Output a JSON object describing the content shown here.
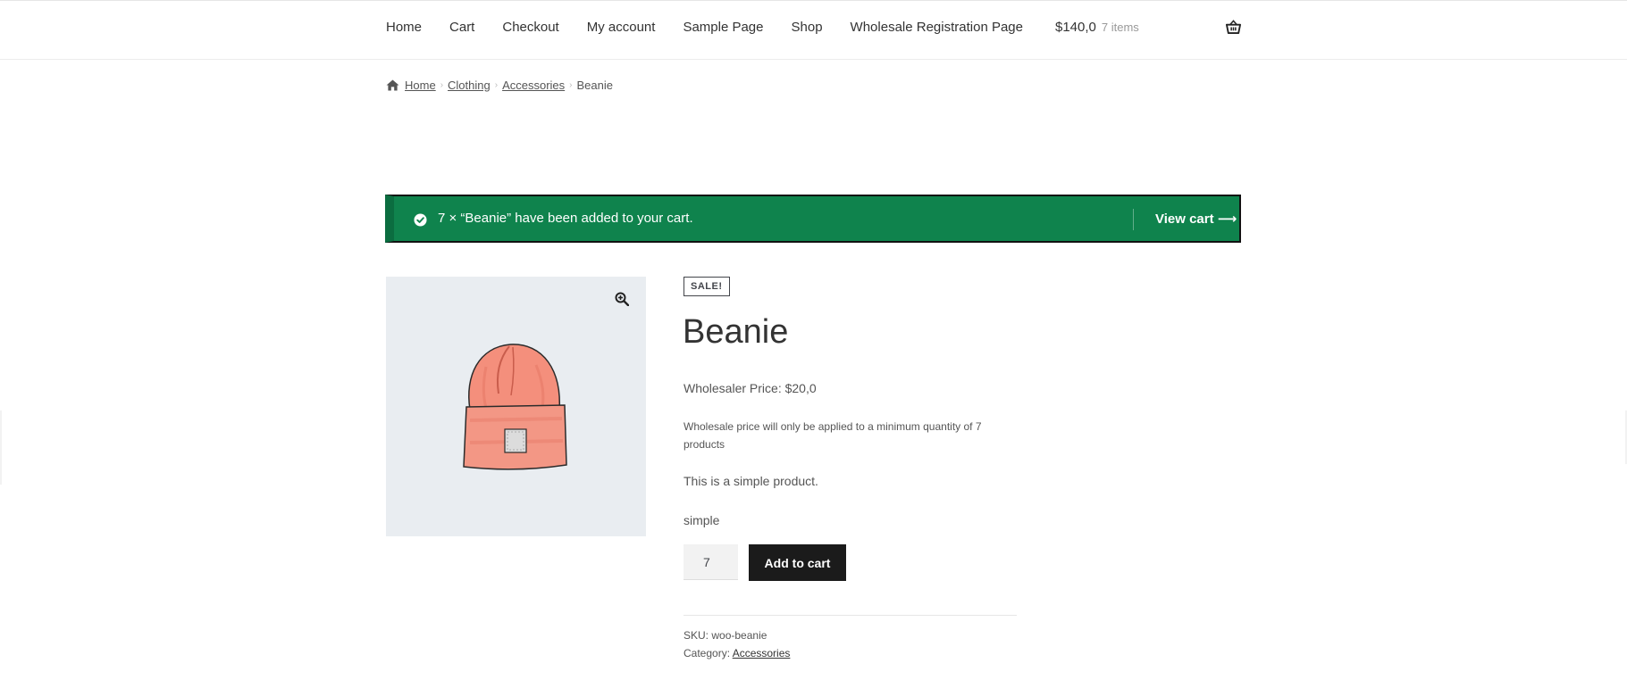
{
  "nav": {
    "items": [
      {
        "label": "Home"
      },
      {
        "label": "Cart"
      },
      {
        "label": "Checkout"
      },
      {
        "label": "My account"
      },
      {
        "label": "Sample Page"
      },
      {
        "label": "Shop"
      },
      {
        "label": "Wholesale Registration Page"
      }
    ]
  },
  "cart": {
    "total": "$140,0",
    "count": "7 items",
    "icon": "basket-icon"
  },
  "breadcrumb": {
    "home_icon": "home-icon",
    "items": [
      {
        "label": "Home",
        "link": true
      },
      {
        "label": "Clothing",
        "link": true
      },
      {
        "label": "Accessories",
        "link": true
      },
      {
        "label": "Beanie",
        "link": false
      }
    ],
    "separator": "›"
  },
  "notice": {
    "icon": "check-circle-icon",
    "message": "7 × “Beanie” have been added to your cart.",
    "action": "View cart",
    "action_arrow": "⟶",
    "background": "#0f834d"
  },
  "product": {
    "badge": "SALE!",
    "title": "Beanie",
    "wholesale_price": "Wholesaler Price: $20,0",
    "wholesale_note": "Wholesale price will only be applied to a minimum quantity of 7 products",
    "description": "This is a simple product.",
    "type": "simple",
    "quantity": "7",
    "add_to_cart": "Add to cart",
    "sku_label": "SKU:",
    "sku": "woo-beanie",
    "category_label": "Category:",
    "category": "Accessories",
    "zoom_icon": "zoom-in-icon"
  }
}
